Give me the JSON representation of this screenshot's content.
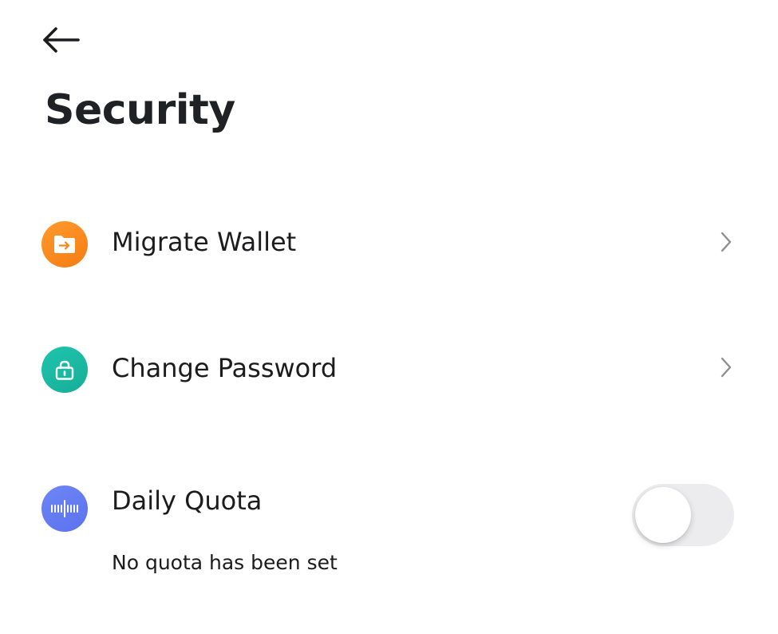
{
  "header": {
    "back_icon": "arrow-left-icon",
    "title": "Security"
  },
  "settings": [
    {
      "id": "migrate-wallet",
      "label": "Migrate Wallet",
      "icon": "folder-arrow-icon",
      "icon_color": "#F7861E",
      "trailing": "chevron-right-icon"
    },
    {
      "id": "change-password",
      "label": "Change Password",
      "icon": "lock-icon",
      "icon_color": "#1BB9A2",
      "trailing": "chevron-right-icon"
    },
    {
      "id": "daily-quota",
      "label": "Daily Quota",
      "icon": "waveform-icon",
      "icon_color": "#6379F0",
      "subtext": "No quota has been set",
      "toggle_on": false
    }
  ]
}
